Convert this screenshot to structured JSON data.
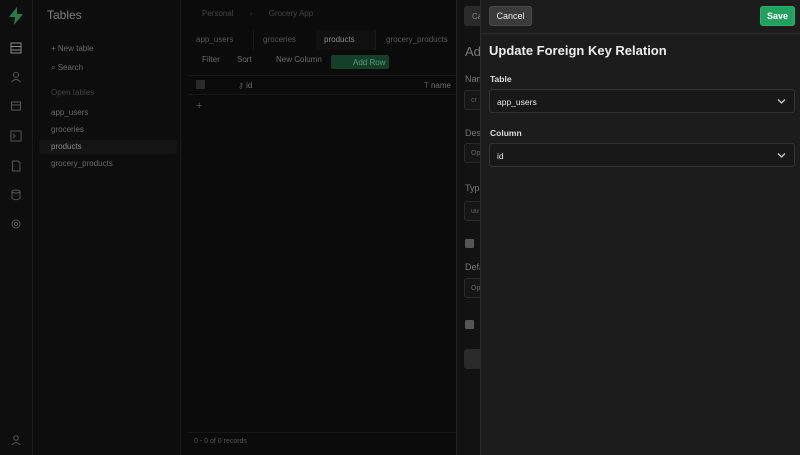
{
  "app": {
    "sidebar_title": "Tables",
    "new_table": "New table",
    "search": "Search",
    "open_tables_label": "Open tables",
    "tables": [
      "app_users",
      "groceries",
      "products",
      "grocery_products"
    ]
  },
  "breadcrumbs": [
    "Personal",
    "Grocery App"
  ],
  "tabs": [
    "app_users",
    "groceries",
    "products",
    "grocery_products"
  ],
  "toolbar": {
    "filter": "Filter",
    "sort": "Sort",
    "new_column": "New Column",
    "add_row": "Add Row"
  },
  "grid": {
    "col_id": "id",
    "col_name": "name",
    "records": "0 - 0 of 0 records"
  },
  "column_panel": {
    "cancel": "Ca",
    "title": "Add",
    "name_label": "Nam",
    "name_value": "cr",
    "desc_label": "Desc",
    "desc_placeholder": "Op",
    "type_label": "Type",
    "type_value": "uu",
    "default_label": "Defa",
    "default_placeholder": "Op"
  },
  "fk_panel": {
    "cancel_label": "Cancel",
    "save_label": "Save",
    "title": "Update Foreign Key Relation",
    "table_label": "Table",
    "table_value": "app_users",
    "column_label": "Column",
    "column_value": "id"
  },
  "colors": {
    "accent": "#23a05f",
    "panel_bg": "#1c1c1c"
  }
}
